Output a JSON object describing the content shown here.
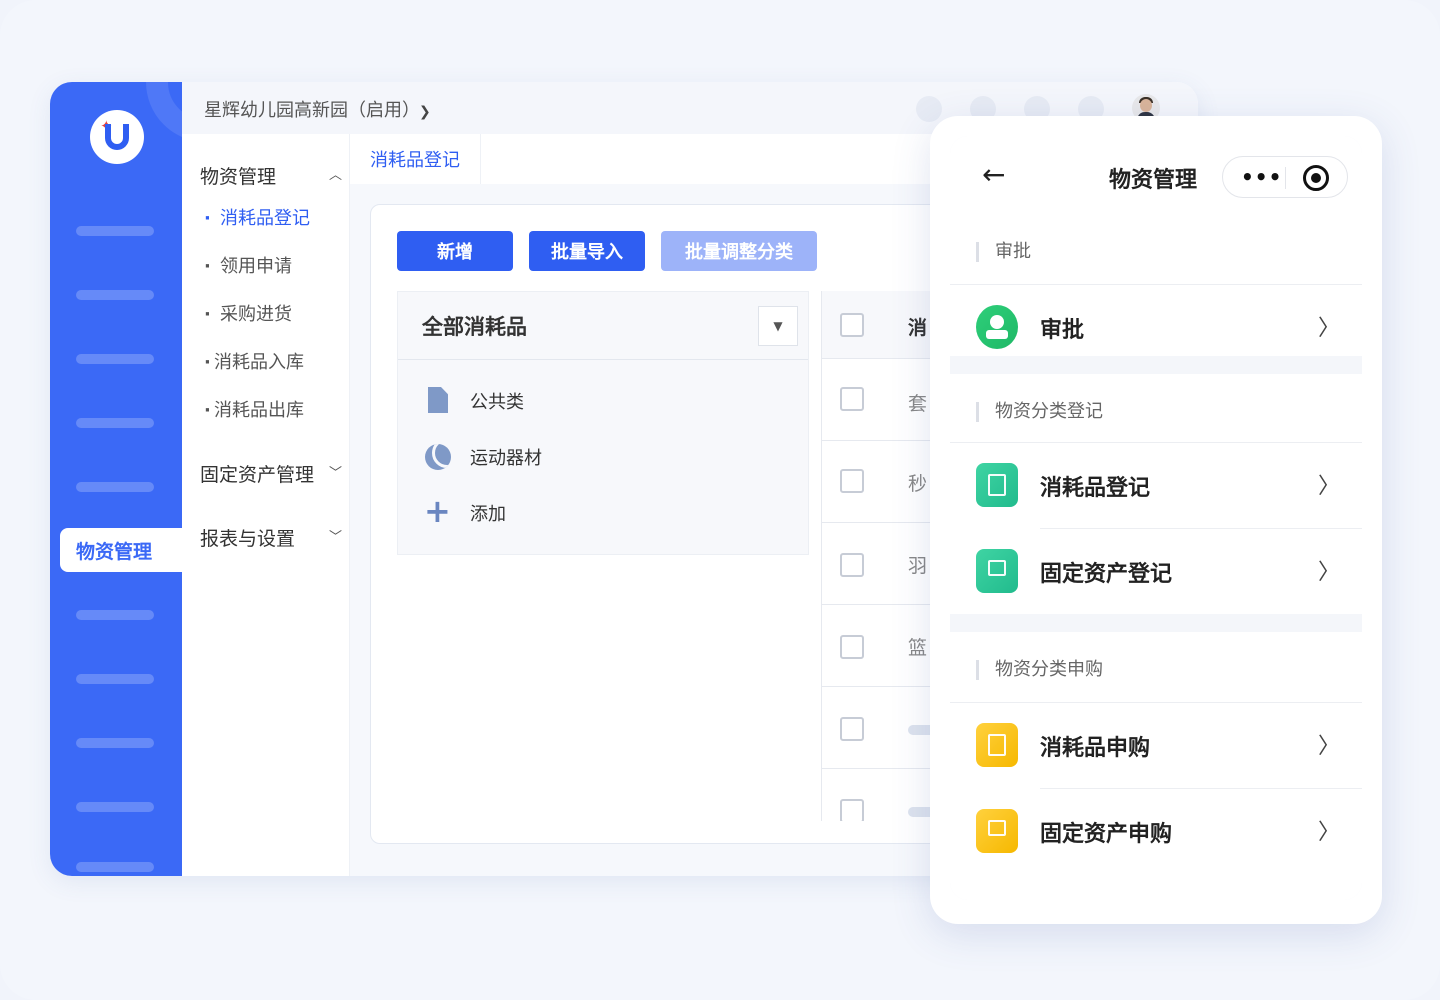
{
  "header": {
    "org_name": "星辉幼儿园高新园（启用）"
  },
  "rail": {
    "active_label": "物资管理"
  },
  "menu": {
    "group1": "物资管理",
    "items": [
      "消耗品登记",
      "领用申请",
      "采购进货",
      "消耗品入库",
      "消耗品出库"
    ],
    "group2": "固定资产管理",
    "group3": "报表与设置"
  },
  "tabs": [
    "消耗品登记"
  ],
  "toolbar": {
    "add": "新增",
    "import": "批量导入",
    "adjust": "批量调整分类"
  },
  "tree": {
    "title": "全部消耗品",
    "items": [
      "公共类",
      "运动器材",
      "添加"
    ]
  },
  "table": {
    "header_cell": "消",
    "rows": [
      "套",
      "秒",
      "羽",
      "篮"
    ]
  },
  "phone": {
    "title": "物资管理",
    "sections": [
      {
        "title": "审批",
        "items": [
          "审批"
        ]
      },
      {
        "title": "物资分类登记",
        "items": [
          "消耗品登记",
          "固定资产登记"
        ]
      },
      {
        "title": "物资分类申购",
        "items": [
          "消耗品申购",
          "固定资产申购"
        ]
      }
    ]
  },
  "colors": {
    "brand": "#3b69f6",
    "primary_button": "#2f5ef2",
    "disabled_button": "#9db3f9",
    "approval_icon": "#1fb866",
    "register_icon": "#21bb8d",
    "purchase_icon": "#f6b800"
  },
  "icons": [
    "logo-icon",
    "chevron-down-icon",
    "chevron-up-icon",
    "file-icon",
    "ball-icon",
    "plus-icon",
    "back-arrow-icon",
    "more-icon",
    "record-icon",
    "chevron-right-icon"
  ]
}
